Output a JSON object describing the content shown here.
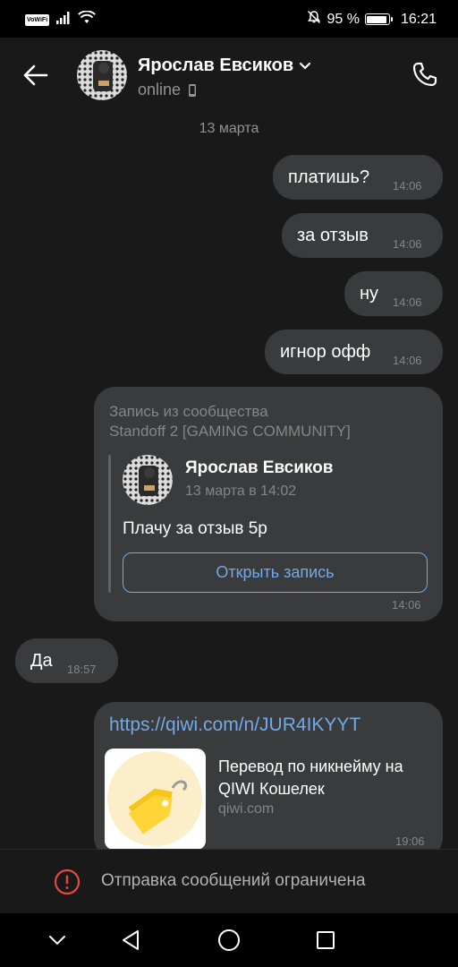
{
  "status_bar": {
    "wifi_badge": "VoWiFi",
    "battery": "95 %",
    "battery_level": 0.95,
    "time": "16:21",
    "icons": [
      "signal-icon",
      "wifi-icon",
      "mute-icon",
      "battery-icon"
    ]
  },
  "header": {
    "contact_name": "Ярослав Евсиков",
    "status": "online",
    "icons": [
      "back-arrow-icon",
      "chevron-down-icon",
      "mobile-icon",
      "phone-icon"
    ]
  },
  "chat": {
    "date_separator": "13 марта",
    "messages": [
      {
        "text": "платишь?",
        "time": "14:06",
        "direction": "outgoing"
      },
      {
        "text": "за отзыв",
        "time": "14:06",
        "direction": "outgoing"
      },
      {
        "text": "ну",
        "time": "14:06",
        "direction": "outgoing"
      },
      {
        "text": "игнор офф",
        "time": "14:06",
        "direction": "outgoing"
      }
    ],
    "repost": {
      "source_label": "Запись из сообщества",
      "community": "Standoff 2 [GAMING COMMUNITY]",
      "author": "Ярослав Евсиков",
      "date": "13 марта в 14:02",
      "text": "Плачу за отзыв 5р",
      "button_label": "Открыть запись",
      "time": "14:06"
    },
    "incoming": {
      "text": "Да",
      "time": "18:57",
      "direction": "incoming"
    },
    "link_message": {
      "url": "https://qiwi.com/n/JUR4IKYYT",
      "title": "Перевод по никнейму на QIWI Кошелек",
      "domain": "qiwi.com",
      "time": "19:06"
    }
  },
  "restriction": {
    "text": "Отправка сообщений ограничена",
    "icon": "alert-circle-icon",
    "color": "#e64646"
  },
  "nav_bar": {
    "icons": [
      "nav-hide-icon",
      "nav-back-icon",
      "nav-home-icon",
      "nav-recents-icon"
    ]
  },
  "colors": {
    "background": "#19191a",
    "bubble": "#3a3b3c",
    "link": "#71aaeb",
    "secondary_text": "#858585"
  }
}
